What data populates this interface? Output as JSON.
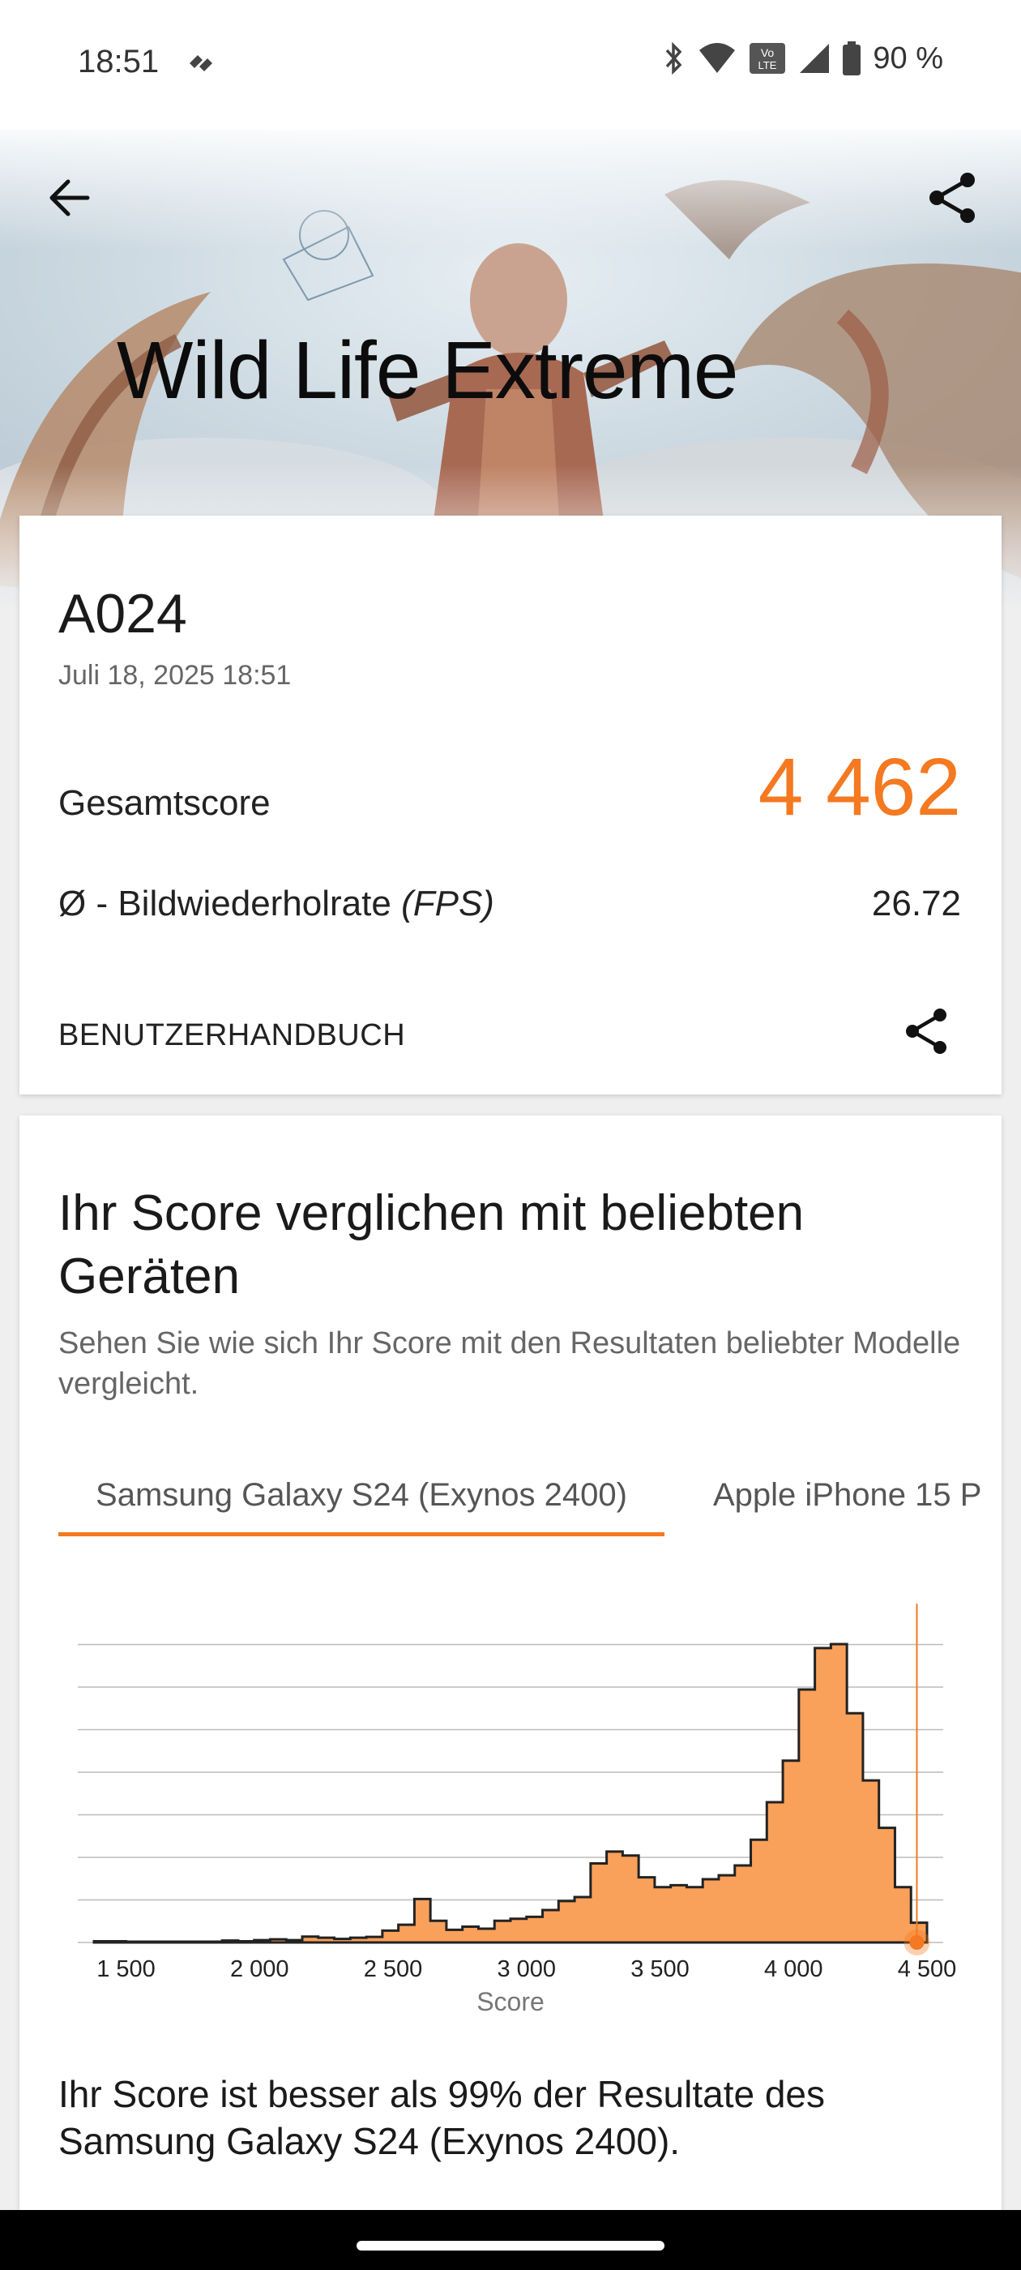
{
  "status_bar": {
    "time": "18:51",
    "battery_percent": "90 %",
    "icons": [
      "app-notification-icon",
      "bluetooth-icon",
      "wifi-icon",
      "volte-icon",
      "signal-icon",
      "battery-icon"
    ]
  },
  "header": {
    "title": "Wild Life Extreme",
    "icons": [
      "back-arrow-icon",
      "share-icon"
    ]
  },
  "result": {
    "device": "A024",
    "date": "Juli 18, 2025 18:51",
    "score_label": "Gesamtscore",
    "score_value": "4 462",
    "fps_label_prefix": "Ø - Bildwiederholrate ",
    "fps_label_unit": "(FPS)",
    "fps_value": "26.72",
    "manual_label": "BENUTZERHANDBUCH"
  },
  "compare": {
    "title": "Ihr Score verglichen mit beliebten Geräten",
    "description": "Sehen Sie wie sich Ihr Score mit den Resultaten beliebter Modelle vergleicht.",
    "tabs": [
      {
        "label": "Samsung Galaxy S24 (Exynos 2400)",
        "selected": true
      },
      {
        "label": "Apple iPhone 15 P",
        "selected": false
      }
    ],
    "result_text": "Ihr Score ist besser als 99% der Resultate des Samsung Galaxy S24 (Exynos 2400)."
  },
  "chart_data": {
    "type": "area",
    "xlabel": "Score",
    "ylabel": "",
    "xlim": [
      1380,
      4500
    ],
    "tick_values": [
      1500,
      2000,
      2500,
      3000,
      3500,
      4000,
      4500
    ],
    "tick_labels": [
      "1 500",
      "2 000",
      "2 500",
      "3 000",
      "3 500",
      "4 000",
      "4 500"
    ],
    "grid": true,
    "highlight_score": 4462,
    "fill_color": "#f9a05a",
    "line_color": "#222222",
    "accent_color": "#f47920",
    "x": [
      1380,
      1440,
      1500,
      1560,
      1620,
      1680,
      1740,
      1800,
      1860,
      1920,
      1980,
      2040,
      2100,
      2160,
      2220,
      2280,
      2340,
      2400,
      2460,
      2520,
      2580,
      2640,
      2700,
      2760,
      2820,
      2880,
      2940,
      3000,
      3060,
      3120,
      3180,
      3240,
      3300,
      3360,
      3420,
      3480,
      3540,
      3600,
      3660,
      3720,
      3780,
      3840,
      3900,
      3960,
      4020,
      4080,
      4140,
      4200,
      4260,
      4320,
      4380,
      4440
    ],
    "y": [
      0.3,
      0.3,
      0.2,
      0.2,
      0.2,
      0.2,
      0.2,
      0.2,
      0.5,
      0.3,
      0.6,
      0.8,
      0.6,
      1.5,
      1.2,
      0.9,
      1.2,
      1.4,
      3.0,
      4.5,
      11.0,
      5.5,
      3.2,
      4.0,
      3.5,
      5.5,
      6.0,
      6.5,
      8.2,
      10.5,
      11.5,
      20.0,
      23.0,
      22.0,
      16.5,
      14.0,
      14.5,
      14.0,
      16.0,
      17.0,
      19.5,
      26.0,
      35.5,
      46.0,
      64.0,
      74.5,
      75.5,
      58.0,
      41.0,
      29.0,
      14.0,
      5.0
    ]
  },
  "colors": {
    "accent": "#f47920",
    "nav_bar": "#000000"
  }
}
